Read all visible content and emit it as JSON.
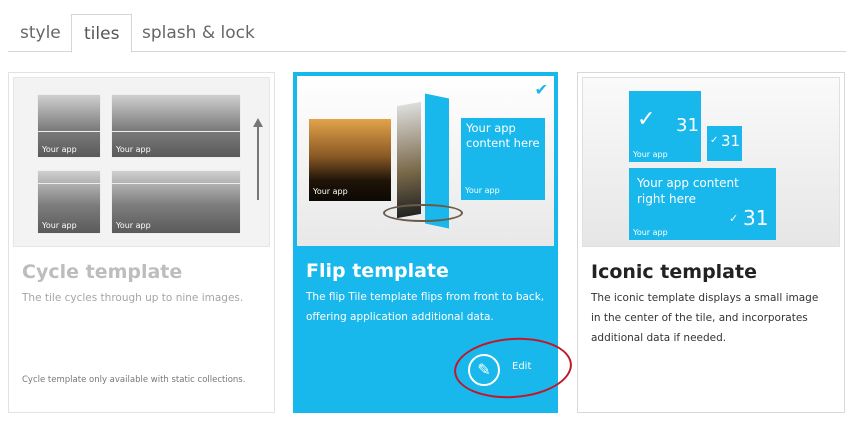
{
  "tabs": [
    {
      "label": "style",
      "active": false
    },
    {
      "label": "tiles",
      "active": true
    },
    {
      "label": "splash & lock",
      "active": false
    }
  ],
  "accent_color": "#18b7ec",
  "annotation_color": "#c0182a",
  "cards": {
    "cycle": {
      "title": "Cycle template",
      "description": "The tile cycles through up to nine images.",
      "note": "Cycle template only available with static collections.",
      "tile_labels": [
        "Your app",
        "Your app",
        "Your app",
        "Your app"
      ],
      "selected": false
    },
    "flip": {
      "title": "Flip template",
      "description": "The flip Tile template flips from front to back, offering application additional data.",
      "front_label": "Your app",
      "back_text": "Your app content here",
      "back_label": "Your app",
      "edit_label": "Edit",
      "edit_icon": "pencil-icon",
      "selected": true
    },
    "iconic": {
      "title": "Iconic template",
      "description": "The iconic template displays a small image in the center of the tile, and incorporates additional data if needed.",
      "medium_count": "31",
      "medium_label": "Your app",
      "small_count": "31",
      "wide_text": "Your app content right here",
      "wide_count": "31",
      "wide_label": "Your app",
      "selected": false
    }
  }
}
